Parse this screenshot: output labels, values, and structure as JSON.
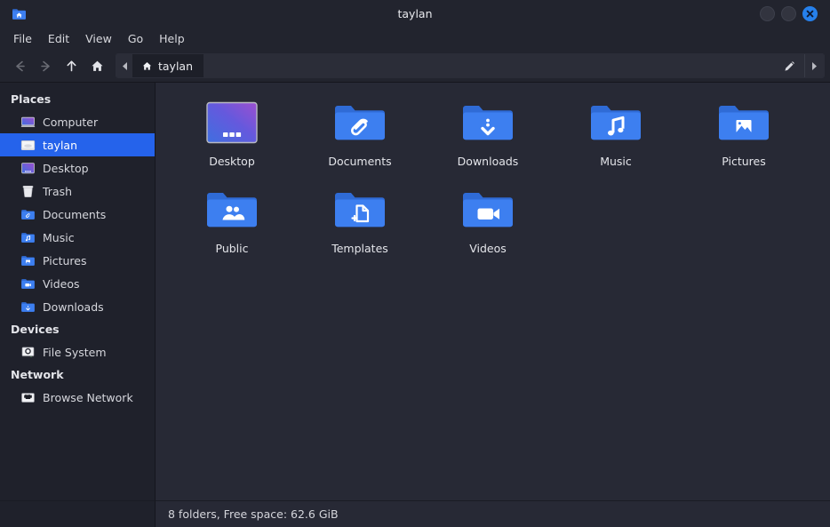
{
  "window": {
    "title": "taylan",
    "icon": "home-folder-icon",
    "controls": [
      {
        "name": "minimize-button",
        "label": ""
      },
      {
        "name": "maximize-button",
        "label": ""
      },
      {
        "name": "close-button",
        "label": "X"
      }
    ]
  },
  "menubar": {
    "items": [
      {
        "label": "File"
      },
      {
        "label": "Edit"
      },
      {
        "label": "View"
      },
      {
        "label": "Go"
      },
      {
        "label": "Help"
      }
    ]
  },
  "toolbar": {
    "back": "back-arrow-icon",
    "forward": "forward-arrow-icon",
    "up": "up-arrow-icon",
    "home": "home-icon",
    "pathbar": {
      "crumb_label": "taylan",
      "crumb_icon": "home-icon",
      "edit_icon": "pencil-icon",
      "scroll_left_icon": "triangle-left-icon",
      "scroll_right_icon": "triangle-right-icon"
    }
  },
  "sidebar": {
    "sections": [
      {
        "header": "Places",
        "items": [
          {
            "label": "Computer",
            "icon": "computer-icon",
            "selected": false
          },
          {
            "label": "taylan",
            "icon": "home-folder-white-icon",
            "selected": true
          },
          {
            "label": "Desktop",
            "icon": "desktop-icon",
            "selected": false
          },
          {
            "label": "Trash",
            "icon": "trash-icon",
            "selected": false
          },
          {
            "label": "Documents",
            "icon": "documents-folder-icon",
            "selected": false
          },
          {
            "label": "Music",
            "icon": "music-folder-icon",
            "selected": false
          },
          {
            "label": "Pictures",
            "icon": "pictures-folder-icon",
            "selected": false
          },
          {
            "label": "Videos",
            "icon": "videos-folder-icon",
            "selected": false
          },
          {
            "label": "Downloads",
            "icon": "downloads-folder-icon",
            "selected": false
          }
        ]
      },
      {
        "header": "Devices",
        "items": [
          {
            "label": "File System",
            "icon": "harddisk-icon",
            "selected": false
          }
        ]
      },
      {
        "header": "Network",
        "items": [
          {
            "label": "Browse Network",
            "icon": "network-icon",
            "selected": false
          }
        ]
      }
    ]
  },
  "files": [
    {
      "label": "Desktop",
      "icon": "desktop-gradient-icon"
    },
    {
      "label": "Documents",
      "icon": "documents-folder-icon"
    },
    {
      "label": "Downloads",
      "icon": "downloads-folder-icon"
    },
    {
      "label": "Music",
      "icon": "music-folder-icon"
    },
    {
      "label": "Pictures",
      "icon": "pictures-folder-icon"
    },
    {
      "label": "Public",
      "icon": "public-folder-icon"
    },
    {
      "label": "Templates",
      "icon": "templates-folder-icon"
    },
    {
      "label": "Videos",
      "icon": "videos-folder-icon"
    }
  ],
  "statusbar": {
    "text": "8 folders, Free space: 62.6 GiB"
  },
  "colors": {
    "window_bg": "#22242e",
    "sidebar_bg": "#1f212b",
    "content_bg": "#272935",
    "accent": "#2563eb",
    "folder_blue": "#3d7ff0",
    "folder_blue_dark": "#2f6bd6",
    "close_blue": "#2680eb",
    "text": "#e4e5ea"
  }
}
